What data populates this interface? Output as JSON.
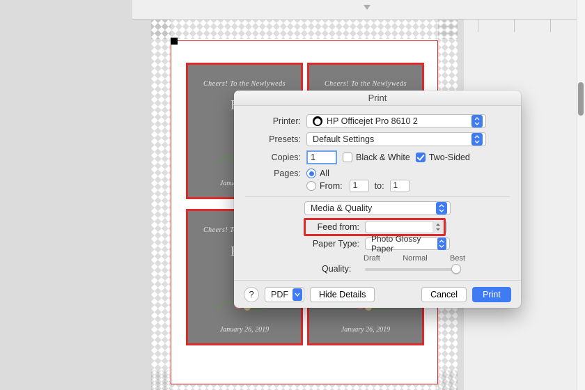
{
  "dialog": {
    "title": "Print",
    "printer_label": "Printer:",
    "printer_value": "HP Officejet Pro 8610 2",
    "presets_label": "Presets:",
    "presets_value": "Default Settings",
    "copies_label": "Copies:",
    "copies_value": "1",
    "bw_label": "Black & White",
    "twosided_label": "Two-Sided",
    "pages_label": "Pages:",
    "pages_all": "All",
    "pages_from": "From:",
    "pages_from_value": "1",
    "pages_to": "to:",
    "pages_to_value": "1",
    "section_value": "Media & Quality",
    "feed_label": "Feed from:",
    "paper_label": "Paper Type:",
    "paper_value": "Photo Glossy Paper",
    "quality_label": "Quality:",
    "q_draft": "Draft",
    "q_normal": "Normal",
    "q_best": "Best",
    "help": "?",
    "pdf": "PDF",
    "hide": "Hide Details",
    "cancel": "Cancel",
    "print": "Print"
  },
  "cards": {
    "cheers": "Cheers! To the Newlyweds",
    "names": "Elisa",
    "date": "January 26, 2019"
  },
  "icons": {
    "updown": "updown",
    "down": "down"
  }
}
